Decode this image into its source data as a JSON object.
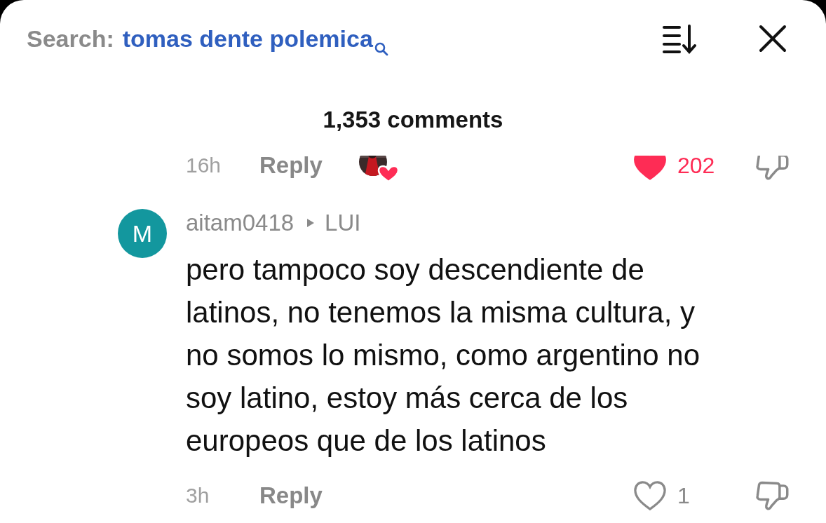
{
  "search": {
    "label": "Search:",
    "query": "tomas dente polemica"
  },
  "comment_count": "1,353 comments",
  "comments": [
    {
      "kind": "partial",
      "time": "16h",
      "reply": "Reply",
      "creator_liked": true,
      "liked": true,
      "likes": "202"
    },
    {
      "kind": "full",
      "avatar_letter": "M",
      "username": "aitam0418",
      "reply_to": "LUI",
      "text": "pero tampoco soy descendiente de latinos, no tenemos la misma cultura, y no somos lo mismo, como argentino no soy latino, estoy más cerca de los europeos que de los latinos",
      "time": "3h",
      "reply": "Reply",
      "liked": false,
      "likes": "1"
    }
  ]
}
